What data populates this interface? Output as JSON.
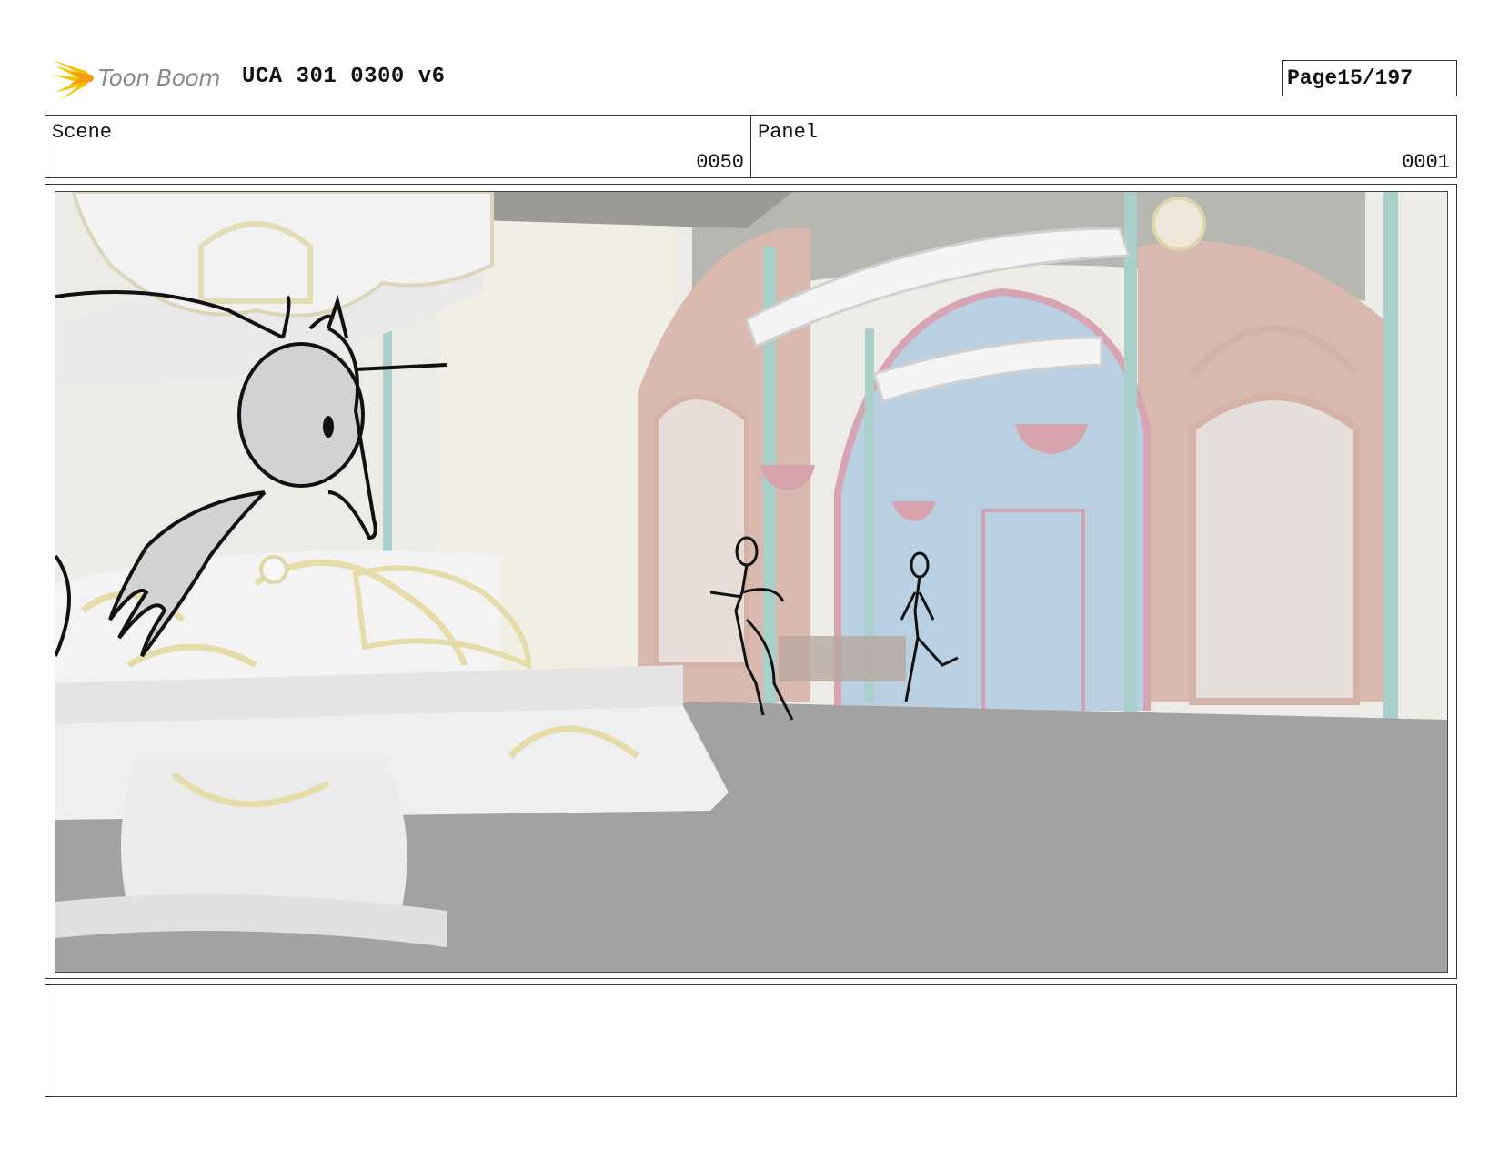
{
  "header": {
    "brand": "Toon Boom",
    "title": "UCA 301 0300 v6",
    "page_label": "Page",
    "page_number": "15/197"
  },
  "info": {
    "scene_label": "Scene",
    "scene_value": "0050",
    "panel_label": "Panel",
    "panel_value": "0001"
  },
  "panel": {
    "description": "",
    "icons": [
      "toon-boom-logo-icon"
    ]
  },
  "notes": {
    "text": ""
  },
  "colors": {
    "logo_yellow": "#f5c400",
    "logo_orange": "#f39c12",
    "brand_grey": "#8a8a8a"
  }
}
